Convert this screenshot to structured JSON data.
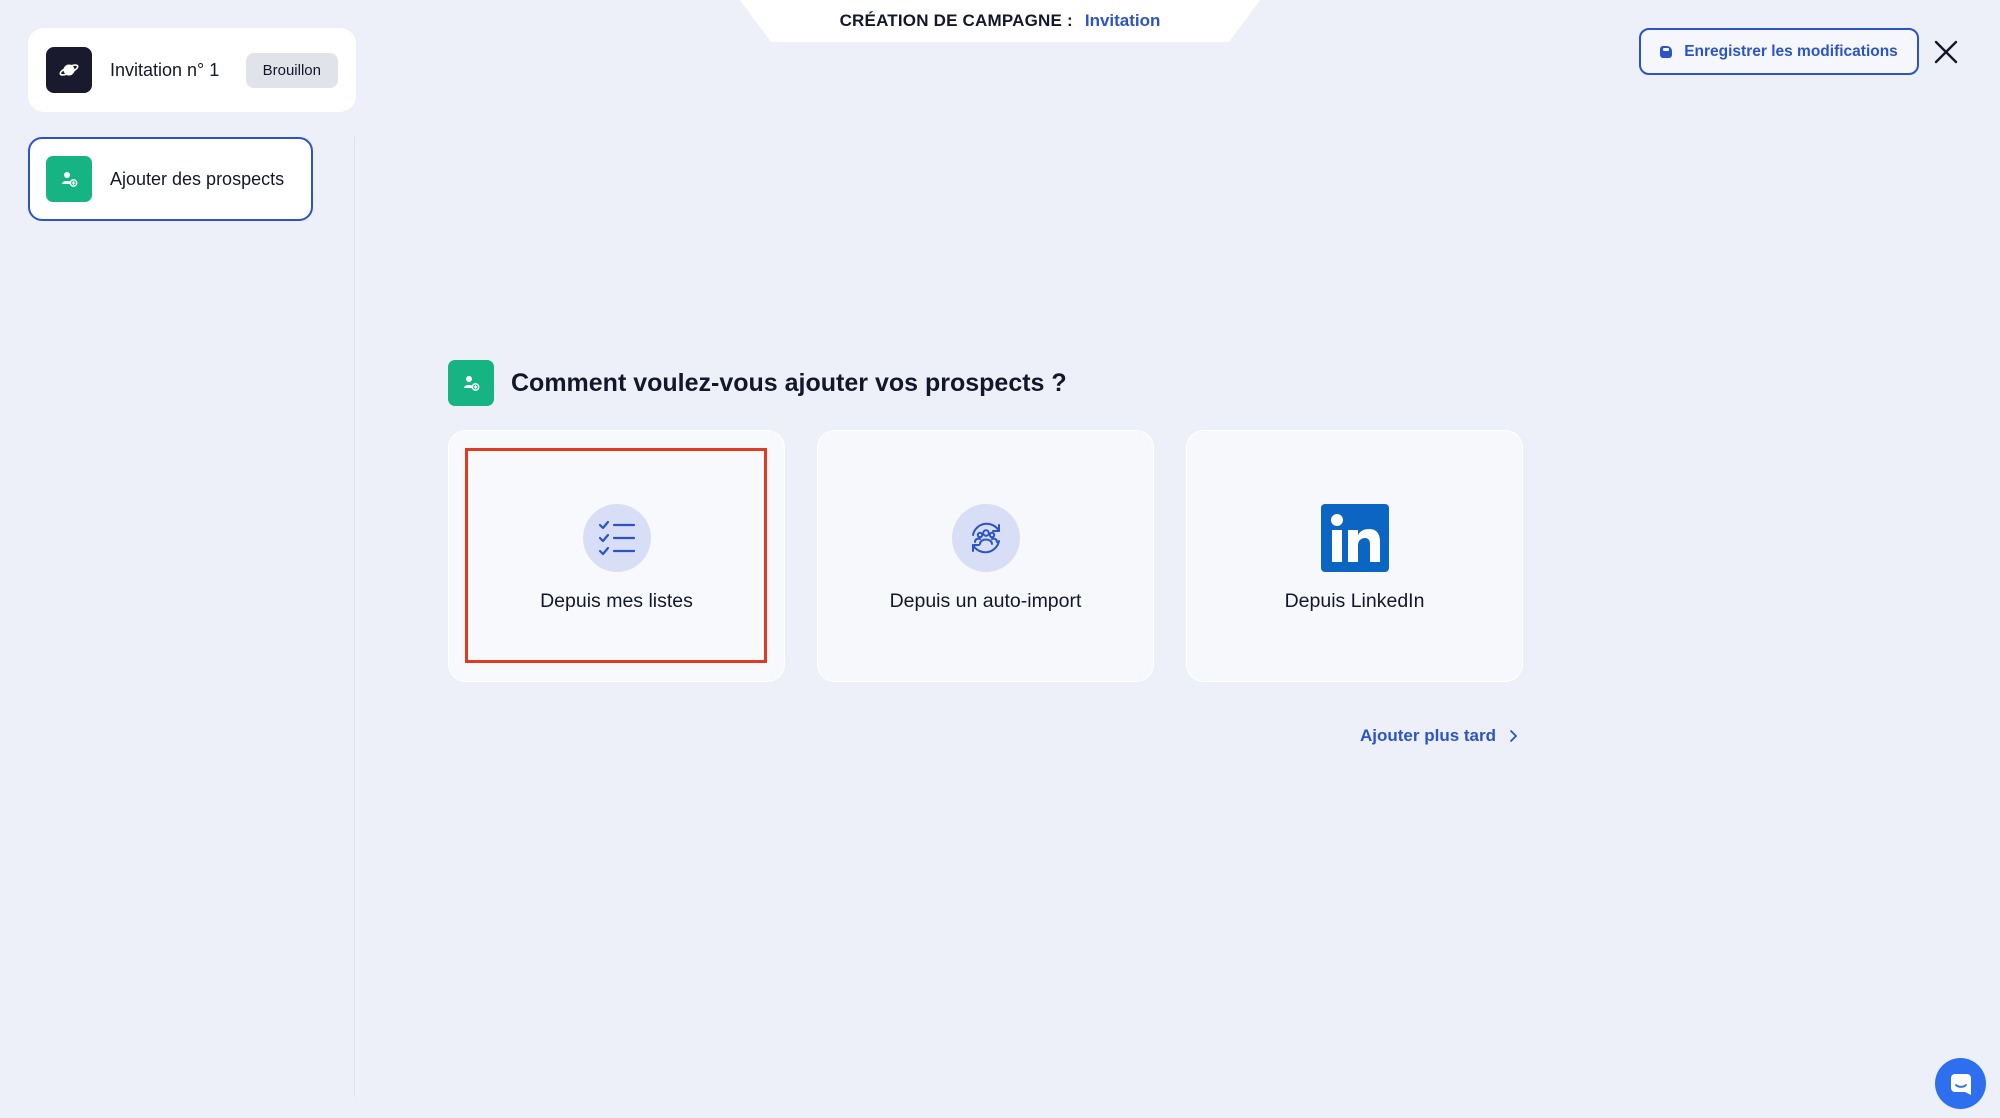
{
  "header": {
    "prefix": "CRÉATION DE CAMPAGNE :",
    "campaign_type": "Invitation",
    "save_label": "Enregistrer les modifications",
    "close_icon": "close-icon"
  },
  "sidebar": {
    "campaign": {
      "title": "Invitation n° 1",
      "status": "Brouillon",
      "icon": "planet-icon"
    },
    "steps": [
      {
        "label": "Ajouter des prospects",
        "icon": "add-user-icon",
        "active": true
      }
    ]
  },
  "main": {
    "question": "Comment voulez-vous ajouter vos prospects ?",
    "options": [
      {
        "label": "Depuis mes listes",
        "icon": "checklist-icon",
        "selected": true
      },
      {
        "label": "Depuis un auto-import",
        "icon": "auto-import-icon",
        "selected": false
      },
      {
        "label": "Depuis LinkedIn",
        "icon": "linkedin-icon",
        "selected": false
      }
    ],
    "later_label": "Ajouter plus tard"
  },
  "colors": {
    "accent": "#2d54c7",
    "green": "#16b483",
    "background": "#edf0f9",
    "highlight": "#e03a22",
    "linkedin": "#0a66c2"
  },
  "chat": {
    "icon": "chat-icon"
  }
}
